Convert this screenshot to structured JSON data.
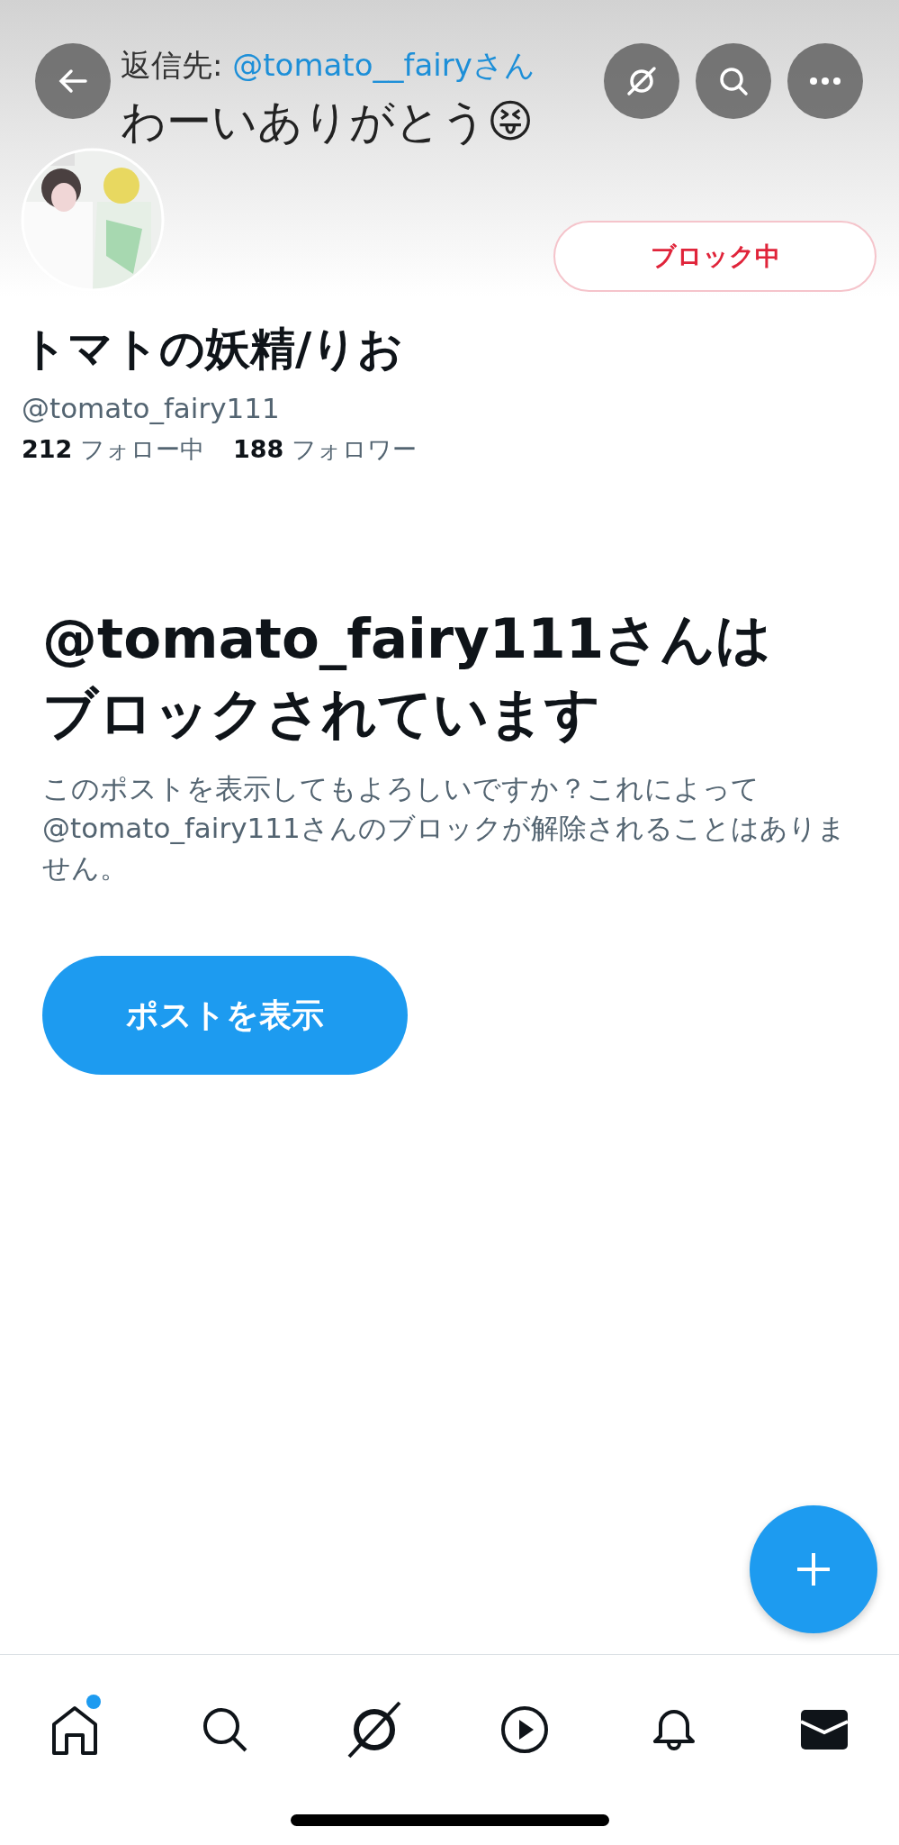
{
  "header": {
    "reply_prefix": "返信先: ",
    "reply_to": "@tomato__fairyさん",
    "tweet_text": "わーいありがとう😝",
    "buttons": [
      {
        "kind": "back"
      },
      {
        "kind": "grok"
      },
      {
        "kind": "search"
      },
      {
        "kind": "more"
      }
    ]
  },
  "profile": {
    "name": "トマトの妖精/りお",
    "handle": "@tomato_fairy111",
    "block_button": "ブロック中",
    "following_count": "212",
    "following_label": "フォロー中",
    "followers_count": "188",
    "followers_label": "フォロワー"
  },
  "notice": {
    "title_lines": [
      "@tomato_fairy111さんは",
      "ブロックされています"
    ],
    "body": "このポストを表示してもよろしいですか？これによって@tomato_fairy111さんのブロックが解除されることはありません。",
    "button": "ポストを表示"
  },
  "nav": [
    {
      "kind": "home",
      "badge": true
    },
    {
      "kind": "search",
      "badge": false
    },
    {
      "kind": "grok",
      "badge": false
    },
    {
      "kind": "video",
      "badge": false
    },
    {
      "kind": "bell",
      "badge": false
    },
    {
      "kind": "mail",
      "badge": false
    }
  ]
}
